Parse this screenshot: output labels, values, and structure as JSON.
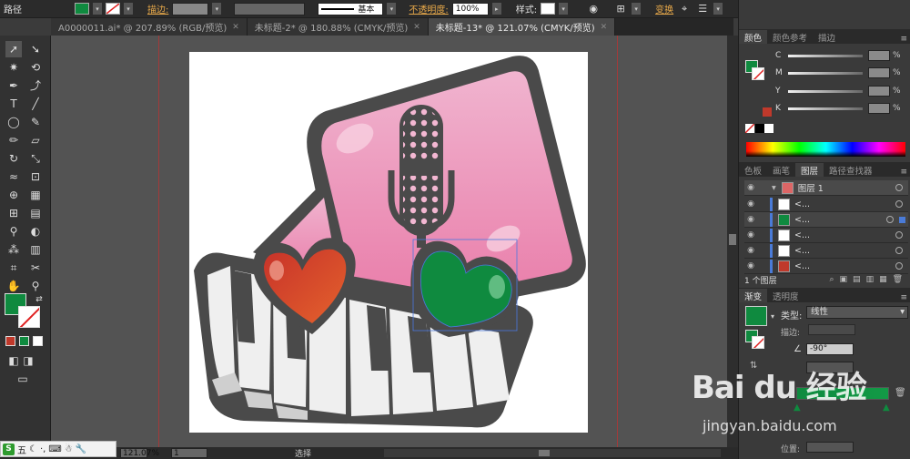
{
  "control_bar": {
    "object_type": "路径",
    "stroke_label": "描边:",
    "stroke_profile": "基本",
    "opacity_label": "不透明度:",
    "opacity_value": "100%",
    "style_label": "样式:",
    "transform_label": "变换"
  },
  "tabs": [
    {
      "label": "A0000011.ai* @ 207.89% (RGB/预览)",
      "active": false
    },
    {
      "label": "未标题-2* @ 180.88% (CMYK/预览)",
      "active": false
    },
    {
      "label": "未标题-13* @ 121.07% (CMYK/预览)",
      "active": true
    }
  ],
  "status_bar": {
    "zoom": "121.07%",
    "page": "1",
    "mode": "选择"
  },
  "color_panel": {
    "tabs": [
      "颜色",
      "颜色参考",
      "描边"
    ],
    "channels": [
      {
        "label": "C",
        "unit": "%"
      },
      {
        "label": "M",
        "unit": "%"
      },
      {
        "label": "Y",
        "unit": "%"
      },
      {
        "label": "K",
        "unit": "%"
      }
    ]
  },
  "layers_panel": {
    "tabs": [
      "色板",
      "画笔",
      "图层",
      "路径查找器"
    ],
    "layer_name": "图层 1",
    "sublayer_placeholder": "<...",
    "footer": "1 个图层"
  },
  "gradient_panel": {
    "tabs": [
      "渐变",
      "透明度"
    ],
    "type_label": "类型:",
    "type_value": "线性",
    "stroke_label": "描边:",
    "angle_value": "-90°",
    "position_label": "位置:"
  },
  "watermark": {
    "main": "Bai du 经验",
    "sub": "jingyan.baidu.com"
  },
  "ime_toolbar": {
    "label": "五"
  },
  "colors": {
    "fill": "#0f8a3f",
    "heart_red": "#d0402c",
    "pink": "#ec8fb8",
    "dark": "#4a4a4a"
  }
}
